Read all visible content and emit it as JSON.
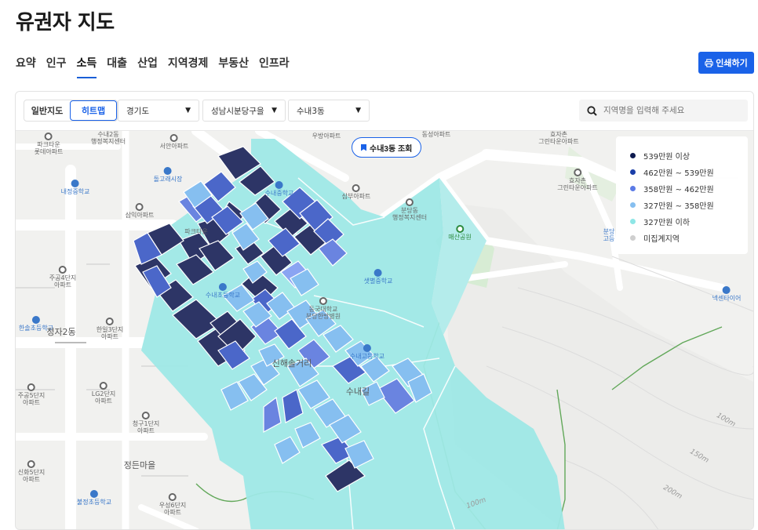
{
  "page": {
    "title": "유권자 지도"
  },
  "tabs": [
    {
      "label": "요약",
      "active": false
    },
    {
      "label": "인구",
      "active": false
    },
    {
      "label": "소득",
      "active": true
    },
    {
      "label": "대출",
      "active": false
    },
    {
      "label": "산업",
      "active": false
    },
    {
      "label": "지역경제",
      "active": false
    },
    {
      "label": "부동산",
      "active": false
    },
    {
      "label": "인프라",
      "active": false
    }
  ],
  "print_button": {
    "label": "인쇄하기",
    "icon": "printer-icon"
  },
  "toolbar": {
    "mode_general": "일반지도",
    "mode_heatmap": "히트맵",
    "province": "경기도",
    "district": "성남시분당구을",
    "dong": "수내3동",
    "search_placeholder": "지역명을 입력해 주세요"
  },
  "map": {
    "view_button": "수내3동 조회",
    "area_labels": {
      "jeongja": "정자2동",
      "jeongdeun": "정든마을",
      "sinhae": "신해솔거리",
      "sunaegil": "수내길"
    },
    "pois": {
      "p1": "파크타운\n롯데아파트",
      "p2": "수내2동\n행정복지센터",
      "p3": "서안아파트",
      "p4": "우방아파트",
      "p5": "동성아파트",
      "p6": "효자촌\n그린타운아파트",
      "p7": "내정중학교",
      "p8": "돌고래시장",
      "p9": "수내중학교",
      "p10": "삼부아파트",
      "p11": "분당동\n행정복지센터",
      "p12": "효자촌\n그린타운아파트",
      "p13": "삼익아파트",
      "p14": "파크타운",
      "p15": "매산공원",
      "p16": "분당\n고등",
      "p17": "주공4단지\n아파트",
      "p18": "수내초등학교",
      "p19": "샛별중학교",
      "p20": "넥센타이어",
      "p21": "한솔초등학교",
      "p22": "한일3단지\n아파트",
      "p23": "동국대학교\n분당한방병원",
      "p24": "수내고등학교",
      "p25": "주공5단지\n아파트",
      "p26": "LG2단지\n아파트",
      "p27": "청구1단지\n아파트",
      "p28": "신화5단지\n아파트",
      "p29": "불정초등학교",
      "p30": "우성6단지\n아파트"
    },
    "contours": [
      "100m",
      "150m",
      "200m",
      "100m"
    ]
  },
  "legend": [
    {
      "label": "539만원 이상",
      "color": "#0d1a4f"
    },
    {
      "label": "462만원 ~ 539만원",
      "color": "#1a3ea8"
    },
    {
      "label": "358만원 ~ 462만원",
      "color": "#5b7ae6"
    },
    {
      "label": "327만원 ~ 358만원",
      "color": "#86bff0"
    },
    {
      "label": "327만원 이하",
      "color": "#8ee6e6"
    },
    {
      "label": "미집계지역",
      "color": "#cfcfcf"
    }
  ]
}
